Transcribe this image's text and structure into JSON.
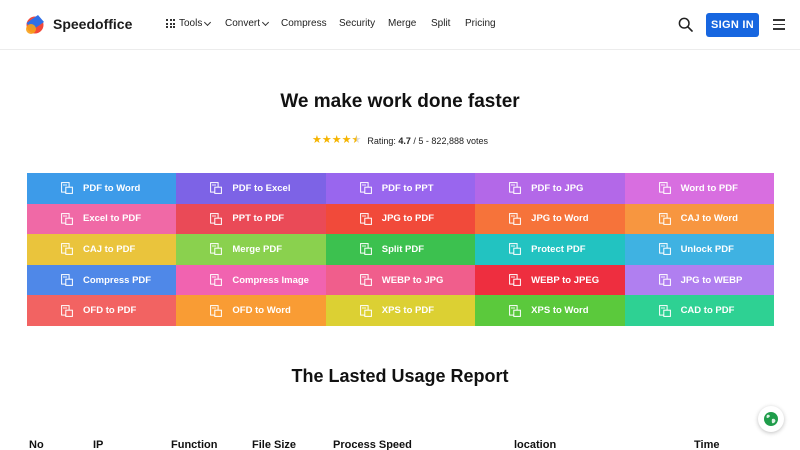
{
  "header": {
    "brand": "Speedoffice",
    "nav": [
      {
        "label": "Tools",
        "has_dropdown": true,
        "icon": "grid-icon"
      },
      {
        "label": "Convert",
        "has_dropdown": true
      },
      {
        "label": "Compress"
      },
      {
        "label": "Security"
      },
      {
        "label": "Merge"
      },
      {
        "label": "Split"
      },
      {
        "label": "Pricing"
      }
    ],
    "signin_label": "SIGN IN"
  },
  "hero": {
    "title": "We make work done faster",
    "rating_prefix": "Rating: ",
    "rating_value": "4.7",
    "rating_suffix": " / 5 - 822,888 votes",
    "stars": 4.5
  },
  "tools": [
    {
      "label": "PDF to Word",
      "color": "#3d9be9"
    },
    {
      "label": "PDF to Excel",
      "color": "#7d63e6"
    },
    {
      "label": "PDF to PPT",
      "color": "#9966ee"
    },
    {
      "label": "PDF to JPG",
      "color": "#b368e8"
    },
    {
      "label": "Word to PDF",
      "color": "#d86ee0"
    },
    {
      "label": "Excel to PDF",
      "color": "#f069a6"
    },
    {
      "label": "PPT to PDF",
      "color": "#ea4a57"
    },
    {
      "label": "JPG to PDF",
      "color": "#f14a3a"
    },
    {
      "label": "JPG to Word",
      "color": "#f6733a"
    },
    {
      "label": "CAJ to Word",
      "color": "#f79640"
    },
    {
      "label": "CAJ to PDF",
      "color": "#eac43c"
    },
    {
      "label": "Merge PDF",
      "color": "#8ad14e"
    },
    {
      "label": "Split PDF",
      "color": "#3cc14f"
    },
    {
      "label": "Protect PDF",
      "color": "#22c3c1"
    },
    {
      "label": "Unlock PDF",
      "color": "#3fb2e2"
    },
    {
      "label": "Compress PDF",
      "color": "#4f88e8"
    },
    {
      "label": "Compress Image",
      "color": "#f163b0"
    },
    {
      "label": "WEBP to JPG",
      "color": "#f05e8c"
    },
    {
      "label": "WEBP to JPEG",
      "color": "#ee2e3f"
    },
    {
      "label": "JPG to WEBP",
      "color": "#b07ff0"
    },
    {
      "label": "OFD to PDF",
      "color": "#f26362"
    },
    {
      "label": "OFD to Word",
      "color": "#f99c34"
    },
    {
      "label": "XPS to PDF",
      "color": "#dcd033"
    },
    {
      "label": "XPS to Word",
      "color": "#5bc93c"
    },
    {
      "label": "CAD to PDF",
      "color": "#2ed193"
    }
  ],
  "report": {
    "title": "The Lasted Usage Report",
    "columns": [
      "No",
      "IP",
      "Function",
      "File Size",
      "Process Speed",
      "location",
      "Time"
    ]
  },
  "colors": {
    "accent": "#1766e0",
    "star": "#f5b400"
  }
}
